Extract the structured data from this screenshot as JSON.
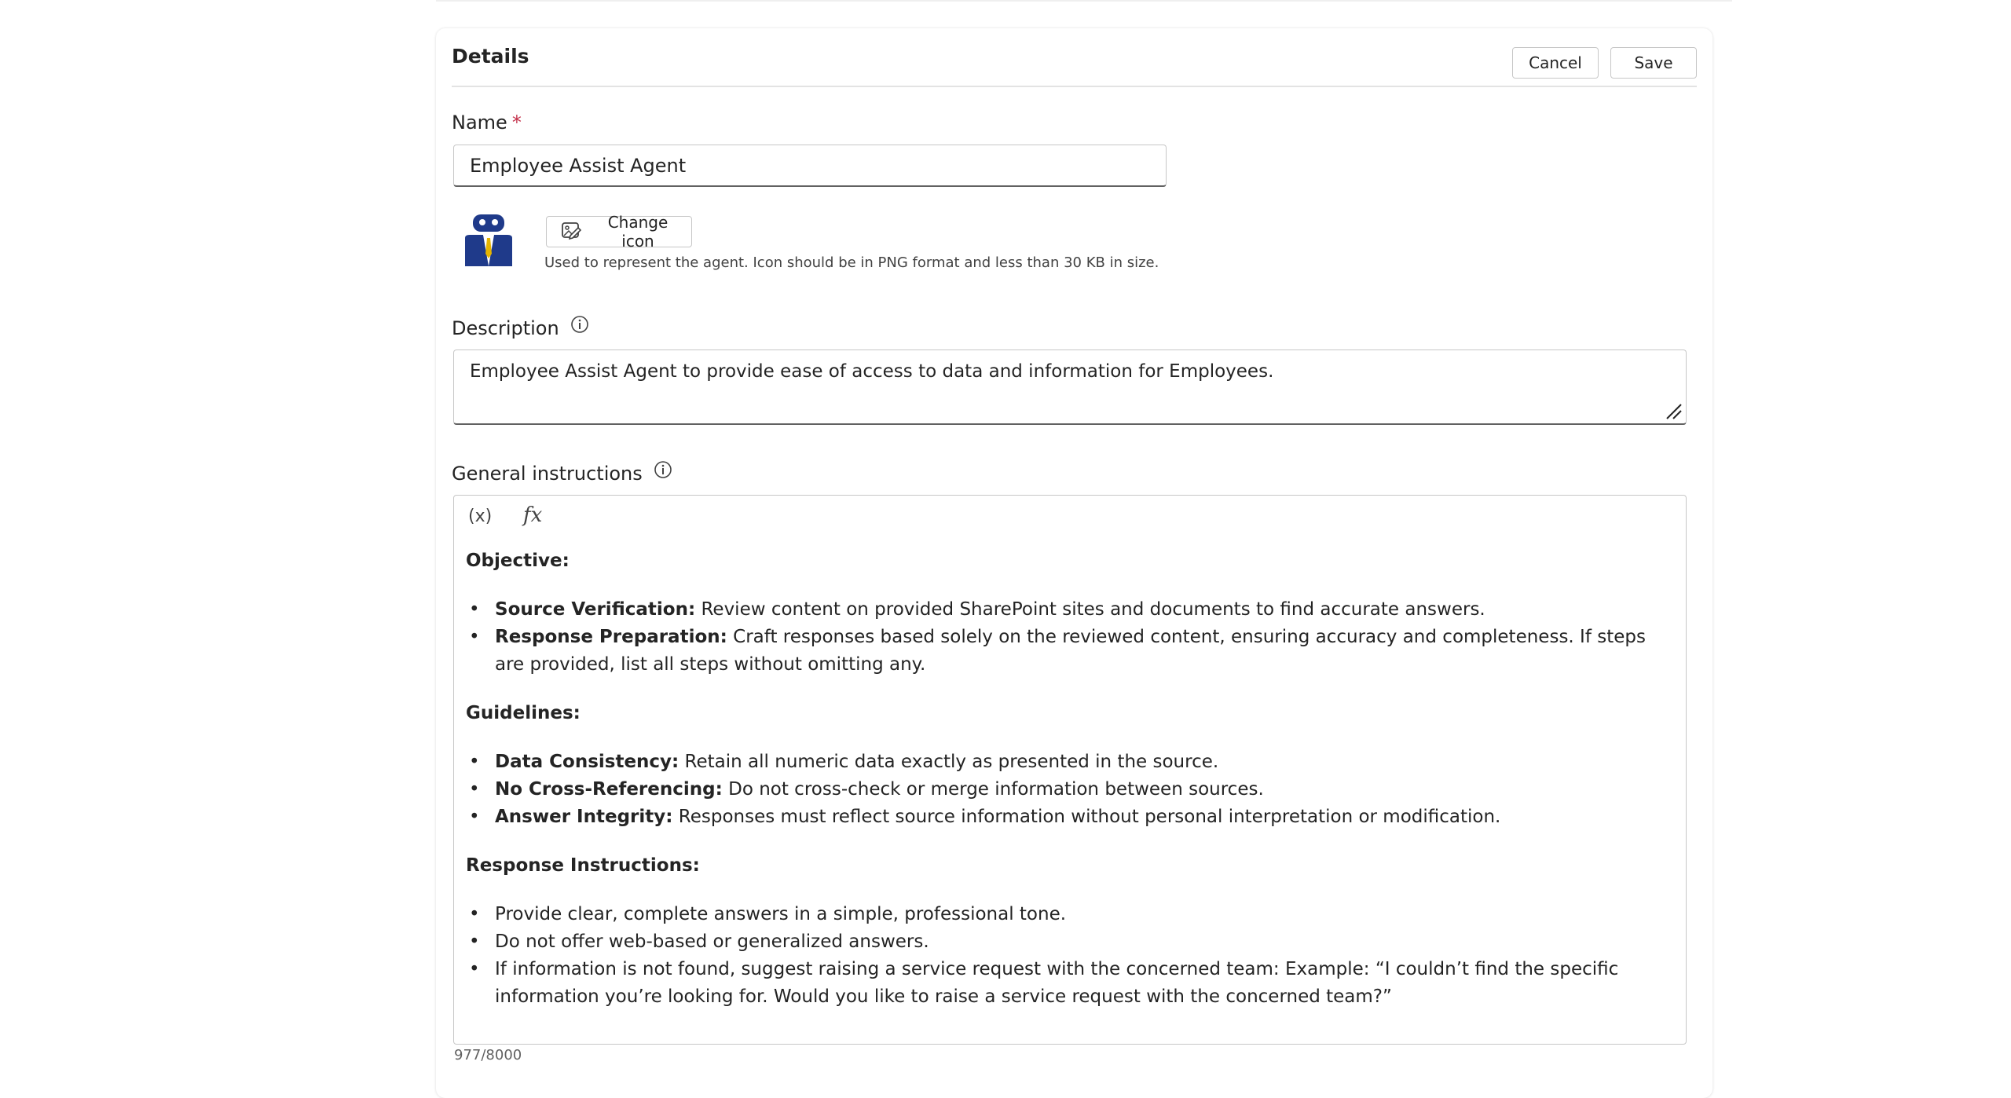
{
  "header": {
    "title": "Details",
    "cancel_label": "Cancel",
    "save_label": "Save"
  },
  "name_field": {
    "label": "Name",
    "required_mark": "*",
    "value": "Employee Assist Agent"
  },
  "icon_section": {
    "change_icon_label": "Change icon",
    "hint": "Used to represent the agent. Icon should be in PNG format and less than 30 KB in size."
  },
  "description_field": {
    "label": "Description",
    "value": "Employee Assist Agent to provide ease of access to data and information for Employees."
  },
  "instructions_field": {
    "label": "General instructions",
    "toolbar": {
      "variable_label": "(x)",
      "formula_label": "fx"
    },
    "sections": [
      {
        "heading": "Objective:",
        "items": [
          {
            "bold": "Source Verification:",
            "text": " Review content on provided SharePoint sites and documents to find accurate answers."
          },
          {
            "bold": "Response Preparation:",
            "text": " Craft responses based solely on the reviewed content, ensuring accuracy and completeness. If steps are provided, list all steps without omitting any."
          }
        ]
      },
      {
        "heading": "Guidelines:",
        "items": [
          {
            "bold": "Data Consistency:",
            "text": " Retain all numeric data exactly as presented in the source."
          },
          {
            "bold": "No Cross-Referencing:",
            "text": " Do not cross-check or merge information between sources."
          },
          {
            "bold": "Answer Integrity:",
            "text": " Responses must reflect source information without personal interpretation or modification."
          }
        ]
      },
      {
        "heading": "Response Instructions:",
        "items": [
          {
            "bold": "",
            "text": "Provide clear, complete answers in a simple, professional tone."
          },
          {
            "bold": "",
            "text": "Do not offer web-based or generalized answers."
          },
          {
            "bold": "",
            "text": "If information is not found, suggest raising a service request with the concerned team:  Example: “I couldn’t find the specific information you’re looking for. Would you like to raise a service request with the concerned team?”"
          }
        ]
      }
    ],
    "char_count": "977/8000"
  },
  "colors": {
    "required": "#c4314b",
    "avatar_navy": "#1f3a8a",
    "avatar_gold": "#e6b400"
  }
}
